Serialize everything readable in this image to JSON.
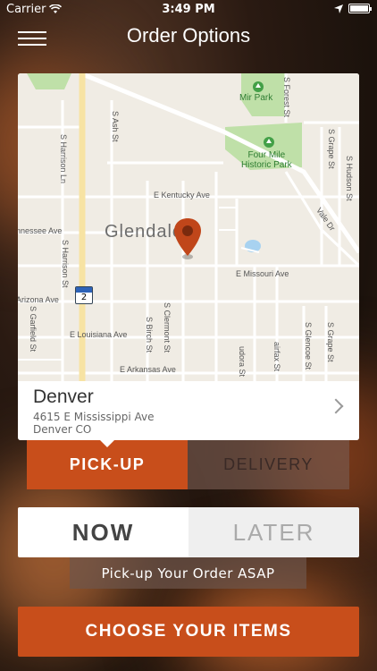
{
  "status": {
    "carrier": "Carrier",
    "time": "3:49 PM"
  },
  "nav": {
    "title": "Order Options"
  },
  "map": {
    "city_label": "Glendale",
    "parks": [
      "Mir Park",
      "Four Mile\nHistoric Park"
    ],
    "streets": {
      "e_kentucky": "E Kentucky Ave",
      "e_missouri": "E Missouri Ave",
      "e_louisiana": "E Louisiana Ave",
      "e_arkansas": "E Arkansas Ave",
      "arizona": "Arizona Ave",
      "tennessee": "nnessee Ave",
      "s_harrison_ln": "S Harrison Ln",
      "s_harrison_st": "S Harrison St",
      "s_ash": "S Ash St",
      "s_garfield": "S Garfield St",
      "s_birch": "S Birch St",
      "s_clermont": "S Clermont St",
      "s_forest": "S Forest St",
      "s_grape": "S Grape St",
      "s_hudson": "S Hudson St",
      "vale_dr": "Vale Dr",
      "s_glencoe": "S Glencoe St",
      "s_grape2": "S Grape St",
      "fairfax": "airfax St",
      "eudora": "udora St"
    },
    "route_shield": "2"
  },
  "location": {
    "city": "Denver",
    "address_line1": "4615 E Mississippi Ave",
    "address_line2": "Denver CO"
  },
  "order_type": {
    "pickup_label": "PICK-UP",
    "delivery_label": "DELIVERY",
    "selected": "pickup"
  },
  "order_time": {
    "now_label": "NOW",
    "later_label": "LATER",
    "selected": "now"
  },
  "asap_text": "Pick-up Your Order ASAP",
  "cta_label": "CHOOSE YOUR ITEMS",
  "colors": {
    "accent": "#c84e1b",
    "pin": "#c0461a"
  }
}
